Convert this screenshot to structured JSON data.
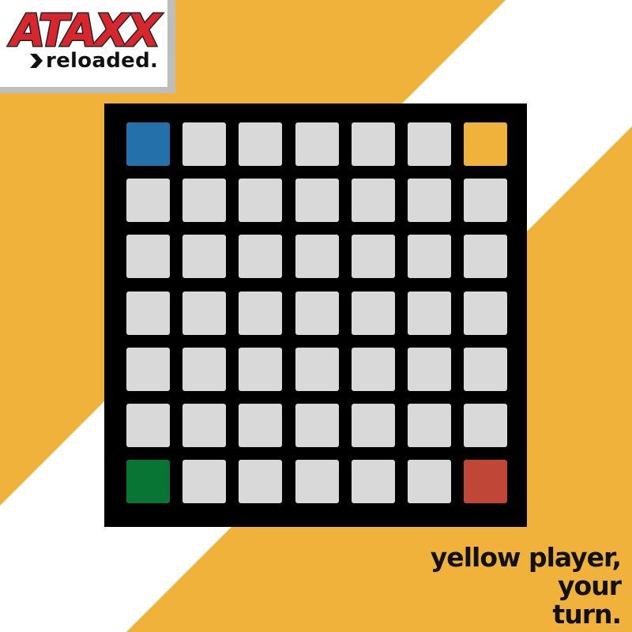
{
  "logo": {
    "title": "ATAXX",
    "subtitle": "reloaded.",
    "title_color": "#d8262f",
    "title_outline": "#222222"
  },
  "colors": {
    "background_primary": "#f0b23b",
    "background_stripe": "#ffffff",
    "board": "#000000",
    "empty_cell": "#d9d9d9",
    "yellow_player": "#f0b23b",
    "blue_player": "#2370ab",
    "green_player": "#087535",
    "red_player": "#c04637"
  },
  "board": {
    "rows": 7,
    "cols": 7,
    "pieces": [
      {
        "row": 0,
        "col": 0,
        "player": "blue"
      },
      {
        "row": 0,
        "col": 6,
        "player": "yellow"
      },
      {
        "row": 6,
        "col": 0,
        "player": "green"
      },
      {
        "row": 6,
        "col": 6,
        "player": "red"
      }
    ]
  },
  "status": {
    "line1": "yellow player,",
    "line2": "your",
    "line3": "turn."
  }
}
